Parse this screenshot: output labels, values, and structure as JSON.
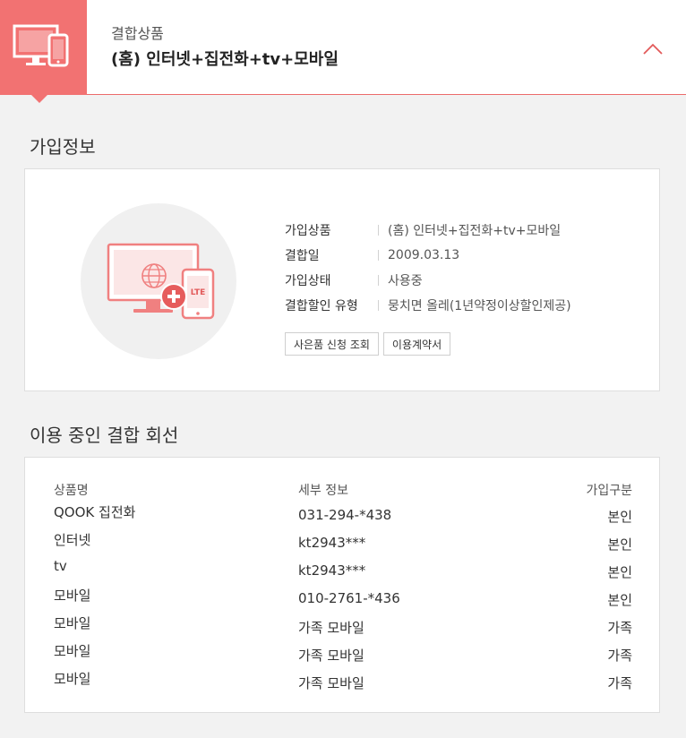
{
  "header": {
    "caption": "결합상품",
    "title": "(홈) 인터넷+집전화+tv+모바일"
  },
  "subscription": {
    "section_title": "가입정보",
    "fields": [
      {
        "label": "가입상품",
        "value": "(홈) 인터넷+집전화+tv+모바일"
      },
      {
        "label": "결합일",
        "value": "2009.03.13"
      },
      {
        "label": "가입상태",
        "value": "사용중"
      },
      {
        "label": "결합할인 유형",
        "value": "뭉치면 올레(1년약정이상할인제공)"
      }
    ],
    "illustration_badge": "LTE",
    "buttons": {
      "gift_lookup": "사은품 신청 조회",
      "terms": "이용계약서"
    }
  },
  "lines": {
    "section_title": "이용 중인 결합 회선",
    "headers": {
      "product": "상품명",
      "detail": "세부 정보",
      "type": "가입구분"
    },
    "rows": [
      {
        "product": "QOOK 집전화",
        "detail": "031-294-*438",
        "type": "본인"
      },
      {
        "product": "인터넷",
        "detail": "kt2943***",
        "type": "본인"
      },
      {
        "product": "tv",
        "detail": "kt2943***",
        "type": "본인"
      },
      {
        "product": "모바일",
        "detail": "010-2761-*436",
        "type": "본인"
      },
      {
        "product": "모바일",
        "detail": "가족 모바일",
        "type": "가족"
      },
      {
        "product": "모바일",
        "detail": "가족 모바일",
        "type": "가족"
      },
      {
        "product": "모바일",
        "detail": "가족 모바일",
        "type": "가족"
      }
    ]
  },
  "colors": {
    "accent": "#f27272",
    "accent_dark": "#e25a5a",
    "background": "#f2f2f2"
  },
  "icons": {
    "header": "monitor-phone-icon",
    "toggle": "chevron-up-icon",
    "illustration": "monitor-globe-phone-lte-icon"
  }
}
